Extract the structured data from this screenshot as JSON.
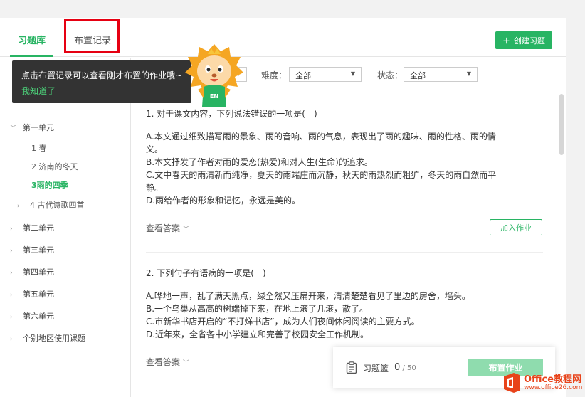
{
  "header": {
    "tabs": [
      {
        "label": "习题库"
      },
      {
        "label": "布置记录"
      }
    ],
    "create_button": "创建习题",
    "create_icon": "plus-icon"
  },
  "filters": {
    "difficulty_label": "难度：",
    "difficulty_value": "全部",
    "status_label": "状态：",
    "status_value": "全部"
  },
  "sidebar": {
    "items": [
      {
        "label": "第一单元",
        "expanded": true
      },
      {
        "label": "1 春"
      },
      {
        "label": "2 济南的冬天"
      },
      {
        "label": "3雨的四季",
        "active": true
      },
      {
        "label": "4 古代诗歌四首"
      },
      {
        "label": "第二单元"
      },
      {
        "label": "第三单元"
      },
      {
        "label": "第四单元"
      },
      {
        "label": "第五单元"
      },
      {
        "label": "第六单元"
      },
      {
        "label": "个别地区使用课题"
      }
    ]
  },
  "tooltip": {
    "text": "点击布置记录可以查看刚才布置的作业哦~",
    "confirm": "我知道了",
    "mascot_badge": "EN"
  },
  "questions": [
    {
      "stem": "1. 对于课文内容，下列说法错误的一项是(　)",
      "options": [
        "A.本文通过细致描写雨的景象、雨的音响、雨的气息，表现出了雨的趣味、雨的性格、雨的情",
        "义。",
        "B.本文抒发了作者对雨的爱恋(热爱)和对人生(生命)的追求。",
        "C.文中春天的雨清新而纯净，夏天的雨端庄而沉静，秋天的雨热烈而粗犷，冬天的雨自然而平",
        "静。",
        "D.雨给作者的形象和记忆，永远是美的。"
      ],
      "view_answer": "查看答案",
      "add_button": "加入作业"
    },
    {
      "stem": "2. 下列句子有语病的一项是(　)",
      "options": [
        "A.哗地一声，乱了满天黑点，绿全然又压扁开来，清清楚楚看见了里边的房舍，墙头。",
        "B.一个鸟巢从高高的树端掉下来，在地上滚了几滚，散了。",
        "C.市新华书店开启的“不打烊书店”，成为人们夜间休闲阅读的主要方式。",
        "D.近年来，全省各中小学建立和完善了校园安全工作机制。"
      ],
      "view_answer": "查看答案"
    }
  ],
  "basket": {
    "label": "习题篮",
    "count": "0",
    "total": " / 50",
    "assign_button": "布置作业"
  },
  "watermark": {
    "title": "Office教程网",
    "url": "www.office26.com"
  },
  "colors": {
    "accent": "#28b463",
    "highlight_border": "#e60012",
    "tooltip_bg": "#333333",
    "watermark": "#e8431a"
  }
}
